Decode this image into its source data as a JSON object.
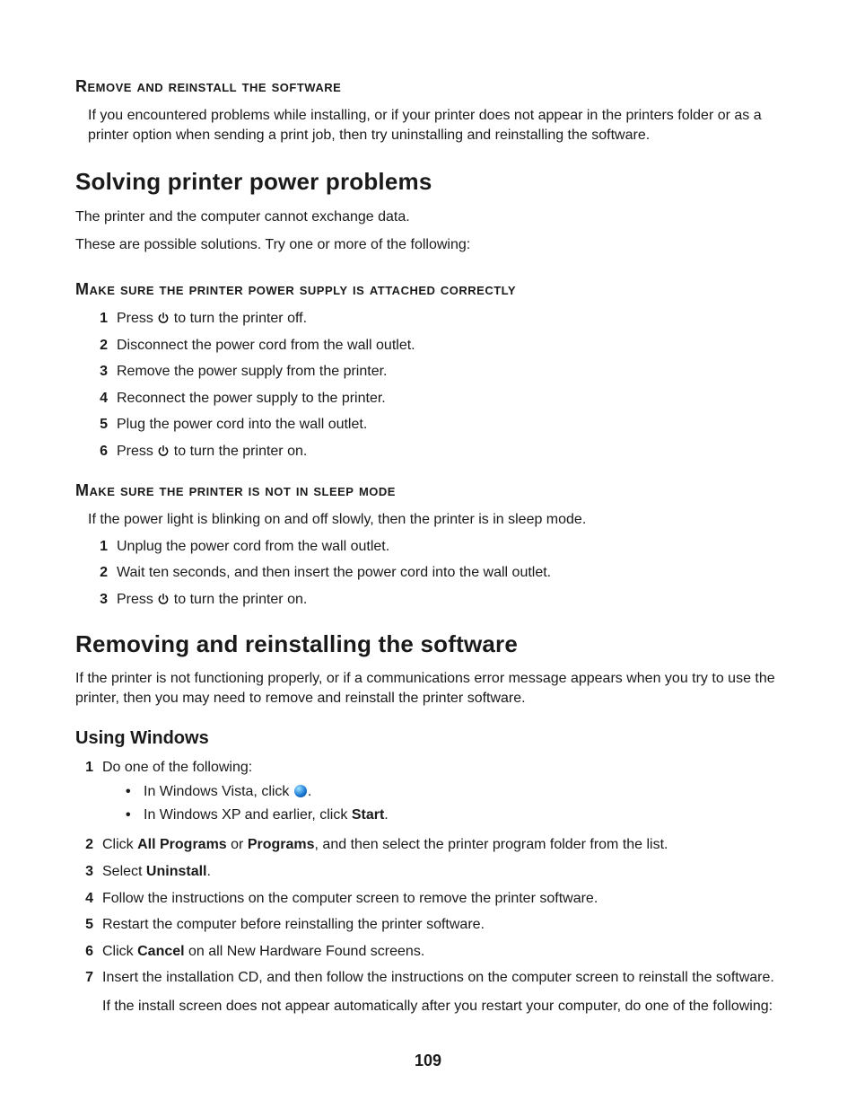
{
  "page_number": "109",
  "sec_a": {
    "heading": "Remove and reinstall the software",
    "body": "If you encountered problems while installing, or if your printer does not appear in the printers folder or as a printer option when sending a print job, then try uninstalling and reinstalling the software."
  },
  "sec_b": {
    "title": "Solving printer power problems",
    "p1": "The printer and the computer cannot exchange data.",
    "p2": "These are possible solutions. Try one or more of the following:",
    "sub1": {
      "heading": "Make sure the printer power supply is attached correctly",
      "steps": [
        {
          "pre": "Press ",
          "icon": "power",
          "post": " to turn the printer off."
        },
        "Disconnect the power cord from the wall outlet.",
        "Remove the power supply from the printer.",
        "Reconnect the power supply to the printer.",
        "Plug the power cord into the wall outlet.",
        {
          "pre": "Press ",
          "icon": "power",
          "post": " to turn the printer on."
        }
      ]
    },
    "sub2": {
      "heading": "Make sure the printer is not in sleep mode",
      "intro": "If the power light is blinking on and off slowly, then the printer is in sleep mode.",
      "steps": [
        "Unplug the power cord from the wall outlet.",
        "Wait ten seconds, and then insert the power cord into the wall outlet.",
        {
          "pre": "Press ",
          "icon": "power",
          "post": " to turn the printer on."
        }
      ]
    }
  },
  "sec_c": {
    "title": "Removing and reinstalling the software",
    "p1": "If the printer is not functioning properly, or if a communications error message appears when you try to use the printer, then you may need to remove and reinstall the printer software.",
    "sub1": {
      "heading": "Using Windows",
      "steps": [
        {
          "text": "Do one of the following:",
          "bullets": [
            {
              "pre": "In Windows Vista, click ",
              "icon": "orb",
              "post": "."
            },
            {
              "pre": "In Windows XP and earlier, click ",
              "bold": "Start",
              "post": "."
            }
          ]
        },
        {
          "runs": [
            {
              "t": "Click "
            },
            {
              "b": "All Programs"
            },
            {
              "t": " or "
            },
            {
              "b": "Programs"
            },
            {
              "t": ", and then select the printer program folder from the list."
            }
          ]
        },
        {
          "runs": [
            {
              "t": "Select "
            },
            {
              "b": "Uninstall"
            },
            {
              "t": "."
            }
          ]
        },
        "Follow the instructions on the computer screen to remove the printer software.",
        "Restart the computer before reinstalling the printer software.",
        {
          "runs": [
            {
              "t": "Click "
            },
            {
              "b": "Cancel"
            },
            {
              "t": " on all New Hardware Found screens."
            }
          ]
        },
        {
          "text": "Insert the installation CD, and then follow the instructions on the computer screen to reinstall the software.",
          "after": "If the install screen does not appear automatically after you restart your computer, do one of the following:"
        }
      ]
    }
  }
}
